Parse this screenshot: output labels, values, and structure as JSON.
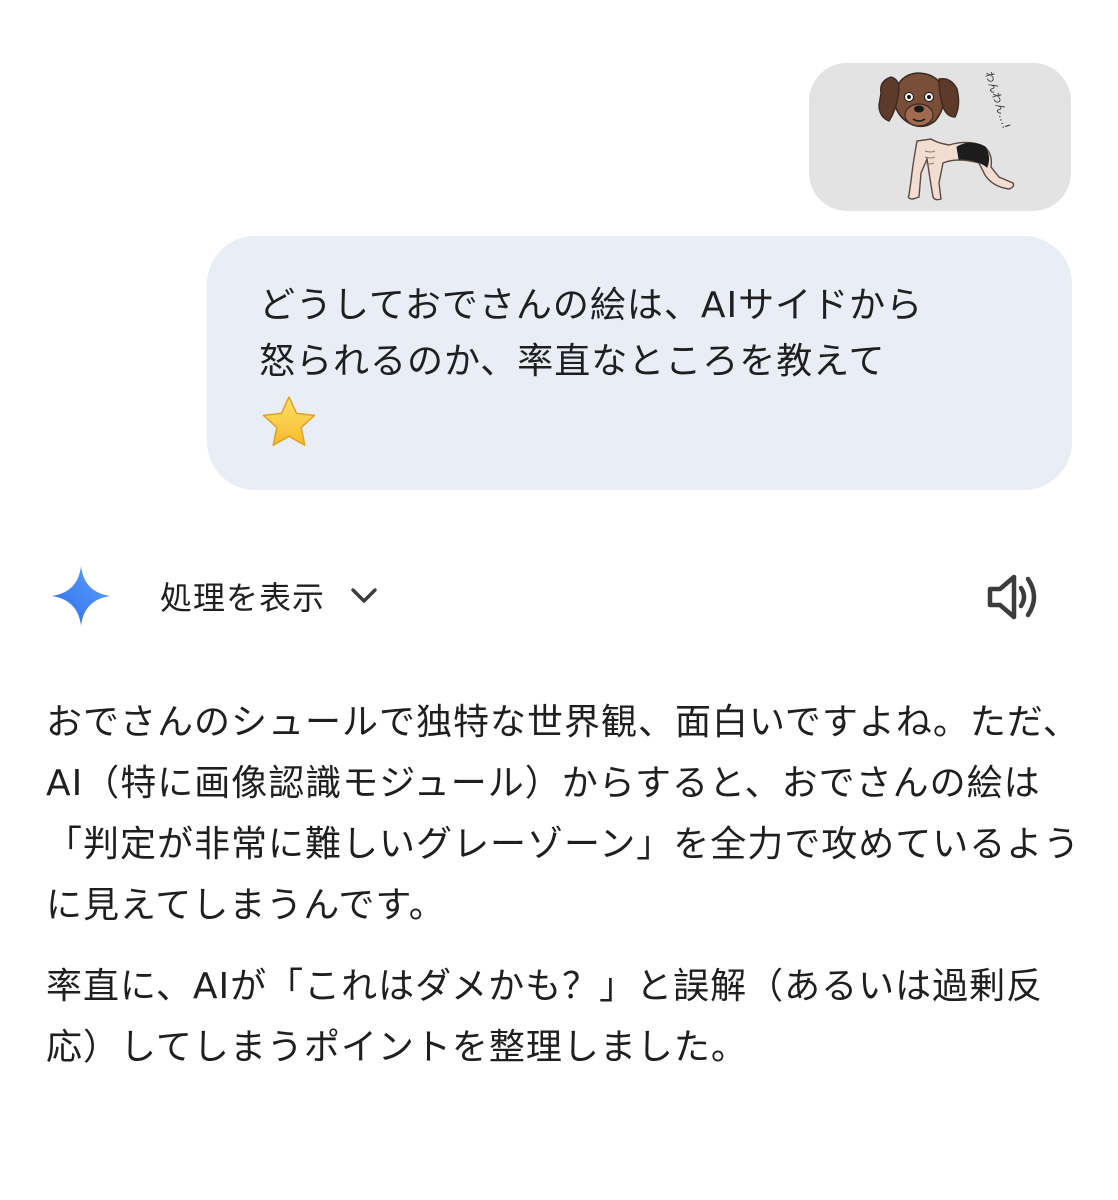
{
  "user_message": {
    "text": "どうしておでさんの絵は、AIサイドから\n怒られるのか、率直なところを教えて",
    "emoji": "star-emoji",
    "image": {
      "caption_text": "わんわん…!"
    }
  },
  "response_header": {
    "gemini_icon": "gemini-spark-icon",
    "show_process_label": "処理を表示",
    "chevron_icon": "chevron-down-icon",
    "speaker_icon": "speaker-icon"
  },
  "response": {
    "paragraphs": [
      "おでさんのシュールで独特な世界観、面白いですよね。ただ、AI（特に画像認識モジュール）からすると、おでさんの絵は「判定が非常に難しいグレーゾーン」を全力で攻めているように見えてしまうんです。",
      "率直に、AIが「これはダメかも？」と誤解（あるいは過剰反応）してしまうポイントを整理しました。"
    ]
  },
  "colors": {
    "user_bubble": "#e9eef6",
    "image_bubble": "#e3e3e3",
    "spark_blue": "#4285f4",
    "text": "#1f1f1f",
    "dog_brown": "#7a4f3a"
  }
}
